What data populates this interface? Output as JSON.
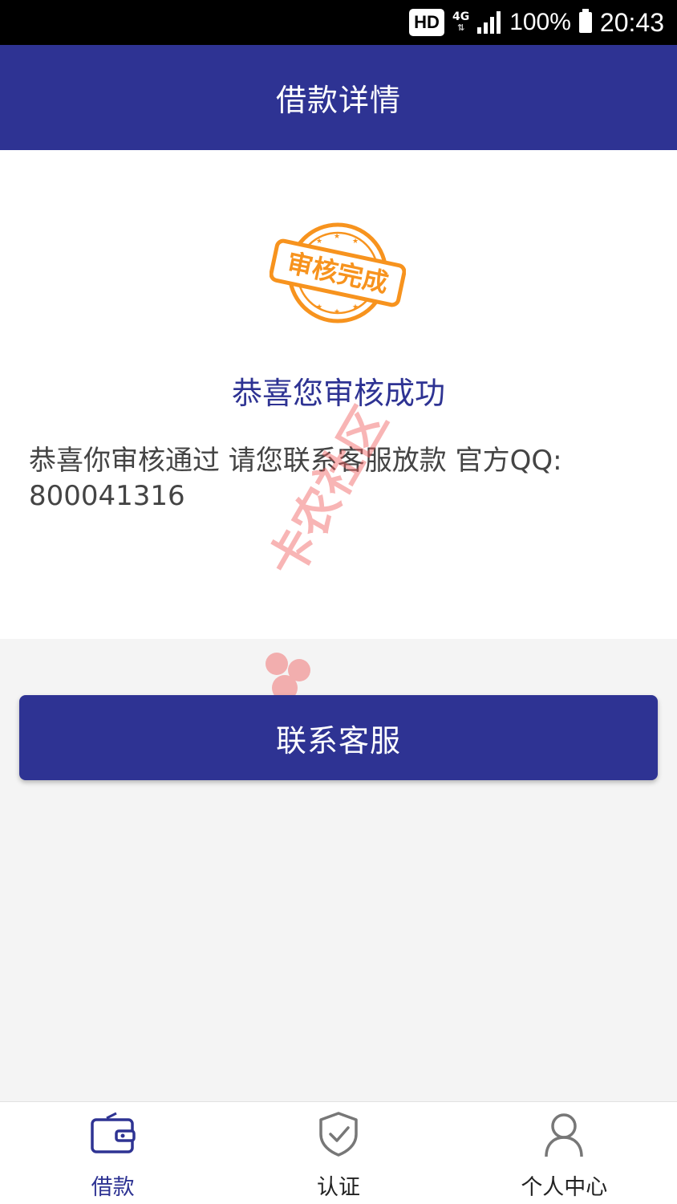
{
  "status_bar": {
    "hd_badge": "HD",
    "network": "4G",
    "battery_percent": "100%",
    "time": "20:43"
  },
  "app_bar": {
    "title": "借款详情"
  },
  "content": {
    "stamp_text": "审核完成",
    "success_title": "恭喜您审核成功",
    "message": "恭喜你审核通过  请您联系客服放款  官方QQ: 800041316"
  },
  "watermark": {
    "text": "卡农社区"
  },
  "contact_button": {
    "label": "联系客服"
  },
  "bottom_nav": {
    "items": [
      {
        "label": "借款",
        "icon": "wallet-icon",
        "active": true
      },
      {
        "label": "认证",
        "icon": "shield-check-icon",
        "active": false
      },
      {
        "label": "个人中心",
        "icon": "person-icon",
        "active": false
      }
    ]
  },
  "colors": {
    "primary": "#2e3393",
    "stamp_orange": "#f7931e",
    "watermark_red": "#f05a5a",
    "page_background": "#f4f4f4"
  }
}
